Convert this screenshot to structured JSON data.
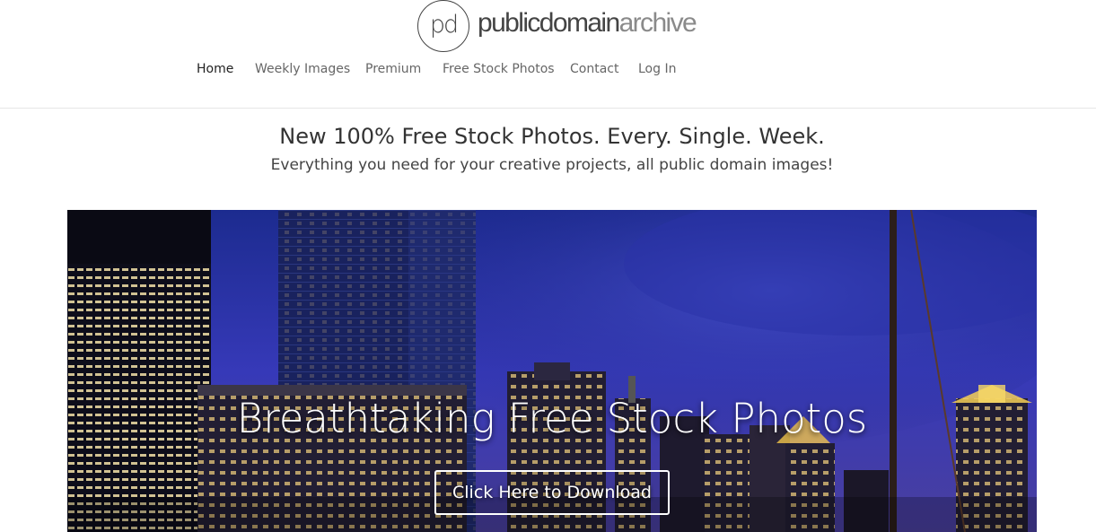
{
  "logo": {
    "mark": "pd",
    "word_a": "publicdomain",
    "word_b": "archive"
  },
  "nav": {
    "items": [
      {
        "label": "Home",
        "active": true
      },
      {
        "label": "Weekly Images",
        "active": false
      },
      {
        "label": "Premium",
        "active": false
      },
      {
        "label": "Free Stock Photos",
        "active": false
      },
      {
        "label": "Contact",
        "active": false
      },
      {
        "label": "Log In",
        "active": false
      }
    ]
  },
  "hero": {
    "headline": "New 100% Free Stock Photos. Every. Single. Week.",
    "subline": "Everything you need for your creative projects, all public domain images!"
  },
  "banner": {
    "title": "Breathtaking Free Stock Photos",
    "cta_label": "Click Here to Download",
    "image_subject": "night-city-skyline"
  },
  "colors": {
    "sky_top": "#1a2a8c",
    "sky_bottom": "#3a3fc0",
    "text_dark": "#333333",
    "nav_text": "#666666"
  }
}
